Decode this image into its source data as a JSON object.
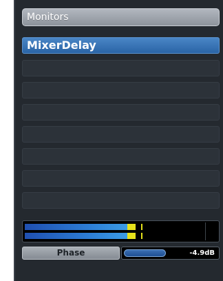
{
  "header": {
    "title": "Monitors"
  },
  "slots": [
    {
      "label": "MixerDelay",
      "active": true
    },
    {
      "label": ""
    },
    {
      "label": ""
    },
    {
      "label": ""
    },
    {
      "label": ""
    },
    {
      "label": ""
    },
    {
      "label": ""
    },
    {
      "label": ""
    }
  ],
  "meter": {
    "left_level": 0.62,
    "right_level": 0.62
  },
  "phase": {
    "button_label": "Phase",
    "value_label": "-4.9dB",
    "level": 0.45
  }
}
